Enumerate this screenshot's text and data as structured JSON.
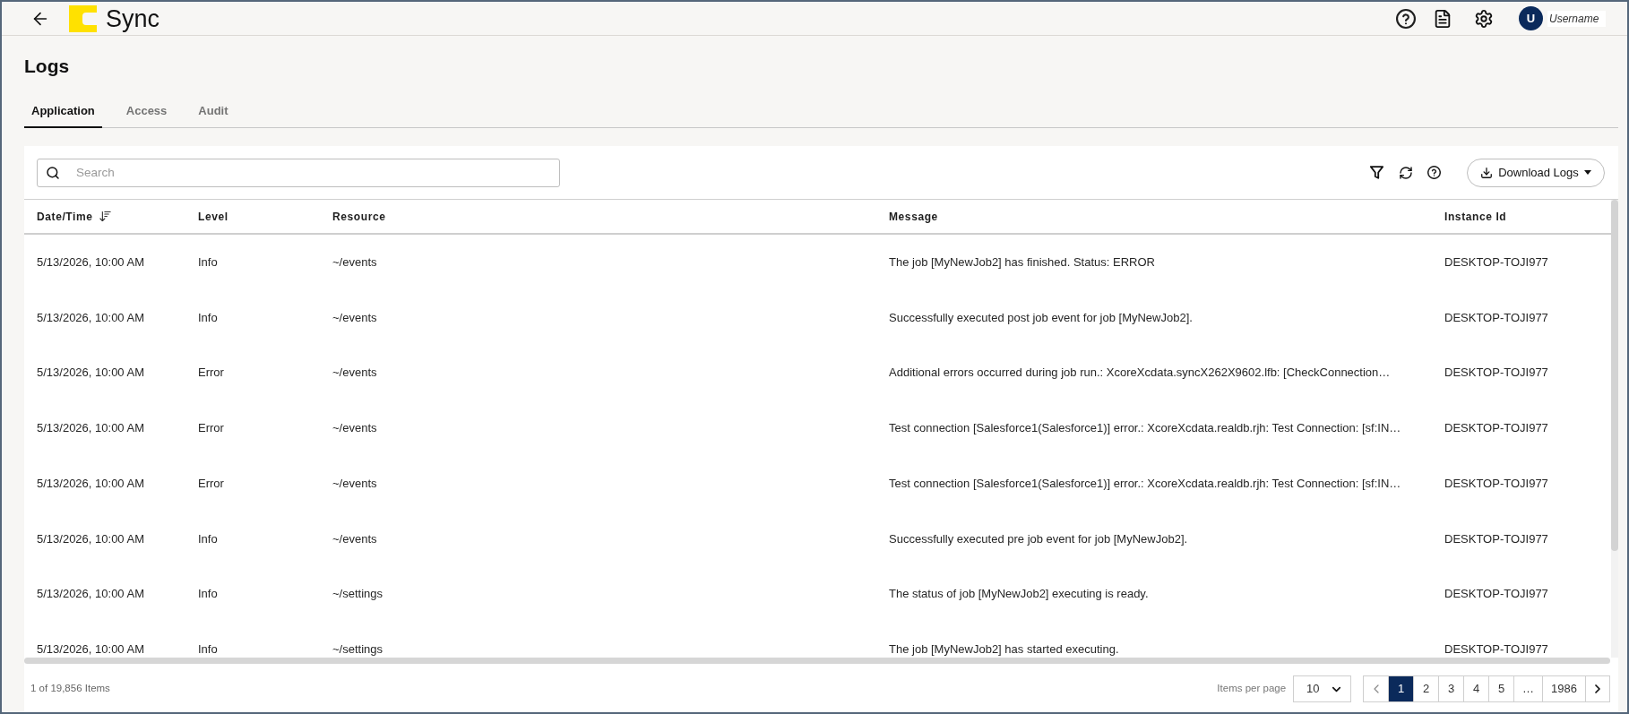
{
  "top_bar": {
    "brand": "Sync",
    "user": {
      "initial": "U",
      "name": "Username"
    }
  },
  "page_title": "Logs",
  "tabs": [
    {
      "label": "Application",
      "selected": true
    },
    {
      "label": "Access",
      "selected": false
    },
    {
      "label": "Audit",
      "selected": false
    }
  ],
  "toolbar": {
    "search": {
      "placeholder": "Search"
    },
    "download_button": "Download Logs"
  },
  "table": {
    "columns": [
      {
        "label": "Date/Time",
        "sorted": true
      },
      {
        "label": "Level",
        "sorted": false
      },
      {
        "label": "Resource",
        "sorted": false
      },
      {
        "label": "Message",
        "sorted": false
      },
      {
        "label": "Instance Id",
        "sorted": false
      }
    ],
    "rows": [
      [
        "5/13/2026, 10:00 AM",
        "Info",
        "~/events",
        "The job [MyNewJob2] has finished. Status: ERROR",
        "DESKTOP-TOJI977"
      ],
      [
        "5/13/2026, 10:00 AM",
        "Info",
        "~/events",
        "Successfully executed post job event for job [MyNewJob2].",
        "DESKTOP-TOJI977"
      ],
      [
        "5/13/2026, 10:00 AM",
        "Error",
        "~/events",
        "Additional errors occurred during job run.: XcoreXcdata.syncX262X9602.lfb: [CheckConnection…",
        "DESKTOP-TOJI977"
      ],
      [
        "5/13/2026, 10:00 AM",
        "Error",
        "~/events",
        "Test connection [Salesforce1(Salesforce1)] error.: XcoreXcdata.realdb.rjh: Test Connection: [sf:IN…",
        "DESKTOP-TOJI977"
      ],
      [
        "5/13/2026, 10:00 AM",
        "Error",
        "~/events",
        "Test connection [Salesforce1(Salesforce1)] error.: XcoreXcdata.realdb.rjh: Test Connection: [sf:IN…",
        "DESKTOP-TOJI977"
      ],
      [
        "5/13/2026, 10:00 AM",
        "Info",
        "~/events",
        "Successfully executed pre job event for job [MyNewJob2].",
        "DESKTOP-TOJI977"
      ],
      [
        "5/13/2026, 10:00 AM",
        "Info",
        "~/settings",
        "The status of job [MyNewJob2] executing is ready.",
        "DESKTOP-TOJI977"
      ],
      [
        "5/13/2026, 10:00 AM",
        "Info",
        "~/settings",
        "The job [MyNewJob2] has started executing.",
        "DESKTOP-TOJI977"
      ]
    ]
  },
  "footer": {
    "count": "1 of 19,856 Items",
    "items_per_page_label": "Items per page",
    "items_per_page": "10",
    "previous": {
      "disabled": true
    },
    "next": {
      "disabled": false
    },
    "pages": [
      {
        "label": "1",
        "selected": true
      },
      {
        "label": "2",
        "selected": false
      },
      {
        "label": "3",
        "selected": false
      },
      {
        "label": "4",
        "selected": false
      },
      {
        "label": "5",
        "selected": false
      },
      {
        "label": "…",
        "selected": false
      },
      {
        "label": "1986",
        "selected": false
      }
    ]
  }
}
